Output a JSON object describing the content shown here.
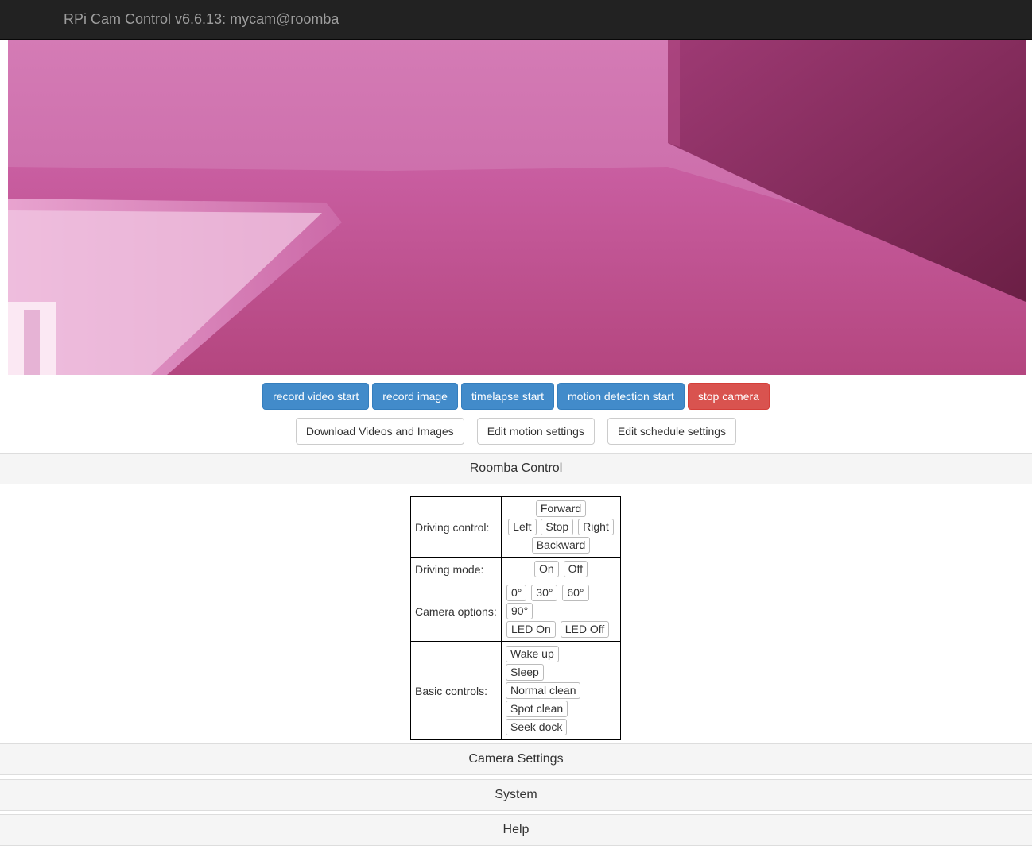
{
  "navbar": {
    "title": "RPi Cam Control v6.6.13: mycam@roomba"
  },
  "toolbar": {
    "record_video": "record video start",
    "record_image": "record image",
    "timelapse": "timelapse start",
    "motion_detection": "motion detection start",
    "stop_camera": "stop camera"
  },
  "links": {
    "download": "Download Videos and Images",
    "edit_motion": "Edit motion settings",
    "edit_schedule": "Edit schedule settings"
  },
  "roomba": {
    "heading": "Roomba Control",
    "driving_control": {
      "label": "Driving control:",
      "forward": "Forward",
      "left": "Left",
      "stop": "Stop",
      "right": "Right",
      "backward": "Backward"
    },
    "driving_mode": {
      "label": "Driving mode:",
      "on": "On",
      "off": "Off"
    },
    "camera_options": {
      "label": "Camera options:",
      "angles": [
        "0°",
        "30°",
        "60°",
        "90°"
      ],
      "led_on": "LED On",
      "led_off": "LED Off"
    },
    "basic_controls": {
      "label": "Basic controls:",
      "wake_up": "Wake up",
      "sleep": "Sleep",
      "normal_clean": "Normal clean",
      "spot_clean": "Spot clean",
      "seek_dock": "Seek dock"
    }
  },
  "panels": {
    "camera_settings": "Camera Settings",
    "system": "System",
    "help": "Help"
  },
  "colors": {
    "primary": "#428bca",
    "danger": "#d9534f",
    "navbar": "#222222",
    "preview_tint": "#c8609f"
  }
}
